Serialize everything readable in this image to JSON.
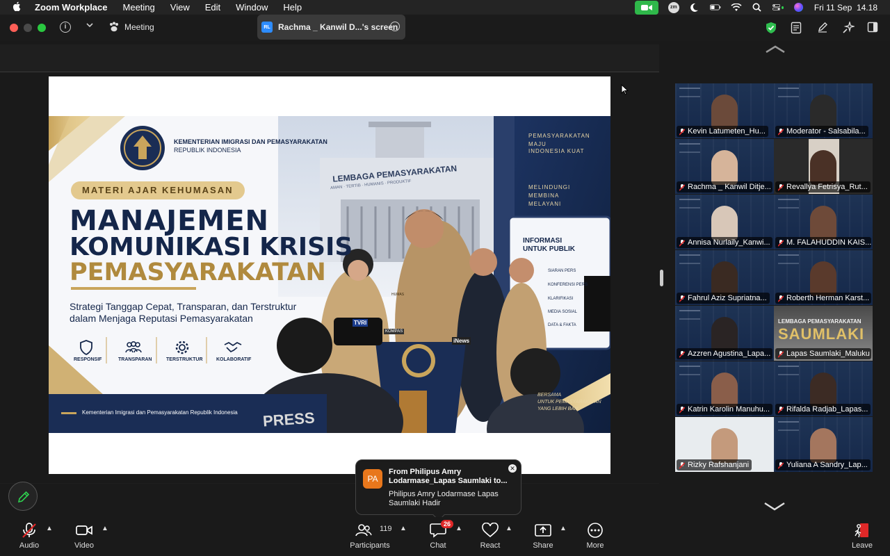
{
  "menubar": {
    "app_name": "Zoom Workplace",
    "items": [
      "Meeting",
      "View",
      "Edit",
      "Window",
      "Help"
    ],
    "clock": "Fri 11 Sep  14.18",
    "zm_label": "zm"
  },
  "titlebar": {
    "meeting_label": "Meeting",
    "share_badge": "RL",
    "share_title": "Rachma _ Kanwil D...'s screen"
  },
  "slide": {
    "ministry_line1": "KEMENTERIAN IMIGRASI DAN PEMASYARAKATAN",
    "ministry_line2": "REPUBLIK INDONESIA",
    "badge": "MATERI AJAR KEHUMASAN",
    "title_line1": "MANAJEMEN",
    "title_line2": "KOMUNIKASI KRISIS",
    "title_line3": "PEMASYARAKATAN",
    "subtitle_line1": "Strategi Tanggap Cepat, Transparan, dan Terstruktur",
    "subtitle_line2": "dalam Menjaga Reputasi Pemasyarakatan",
    "pillars": [
      "RESPONSIF",
      "TRANSPARAN",
      "TERSTRUKTUR",
      "KOLABORATIF"
    ],
    "footer": "Kementerian Imigrasi dan Pemasyarakatan Republik Indonesia",
    "building_sign": "LEMBAGA PEMASYARAKATAN",
    "building_motto": "AMAN · TERTIB · HUMANIS · PRODUKTIF",
    "banner_top": [
      "PEMASYARAKATAN",
      "MAJU",
      "INDONESIA KUAT"
    ],
    "banner_mid": [
      "MELINDUNGI",
      "MEMBINA",
      "MELAYANI"
    ],
    "info_title": [
      "INFORMASI",
      "UNTUK PUBLIK"
    ],
    "info_items": [
      "SIARAN PERS",
      "KONFERENSI PERS",
      "KLARIFIKASI",
      "MEDIA SOSIAL",
      "DATA & FAKTA"
    ],
    "banner_bottom": [
      "BERSAMA",
      "UNTUK PEMASYARAKATAN",
      "YANG LEBIH BAIK"
    ],
    "press": "PRESS",
    "mics": [
      "TVRI",
      "KOMPAS",
      "iNews"
    ],
    "nameplate": "HUMAS",
    "colors": {
      "navy": "#14264a",
      "gold": "#b08a3e",
      "gold_light": "#e9d6a6"
    }
  },
  "gallery": [
    {
      "name": "Kevin Latumeten_Hu...",
      "active": true
    },
    {
      "name": "Moderator - Salsabila..."
    },
    {
      "name": "Rachma _ Kanwil Ditje..."
    },
    {
      "name": "Revallya Fetrisya_Rut..."
    },
    {
      "name": "Annisa Nurlaily_Kanwi..."
    },
    {
      "name": "M. FALAHUDDIN KAIS..."
    },
    {
      "name": "Fahrul Aziz Supriatna..."
    },
    {
      "name": "Roberth Herman Karst..."
    },
    {
      "name": "Azzren Agustina_Lapa..."
    },
    {
      "name": "Lapas Saumlaki_Maluku"
    },
    {
      "name": "Katrin Karolin Manuhu..."
    },
    {
      "name": "Rifalda Radjab_Lapas..."
    },
    {
      "name": "Rizky Rafshanjani"
    },
    {
      "name": "Yuliana A Sandry_Lap..."
    }
  ],
  "saumlaki_tile": {
    "line1": "LEMBAGA PEMASYARAKATAN",
    "line2": "SAUMLAKI"
  },
  "toast": {
    "avatar": "PA",
    "from": "From Philipus Amry Lodarmase_Lapas Saumlaki to...",
    "message": "Philipus Amry Lodarmase Lapas Saumlaki Hadir"
  },
  "toolbar": {
    "audio": "Audio",
    "video": "Video",
    "participants": "Participants",
    "participants_count": "119",
    "chat": "Chat",
    "chat_badge": "26",
    "react": "React",
    "share": "Share",
    "more": "More",
    "leave": "Leave"
  }
}
